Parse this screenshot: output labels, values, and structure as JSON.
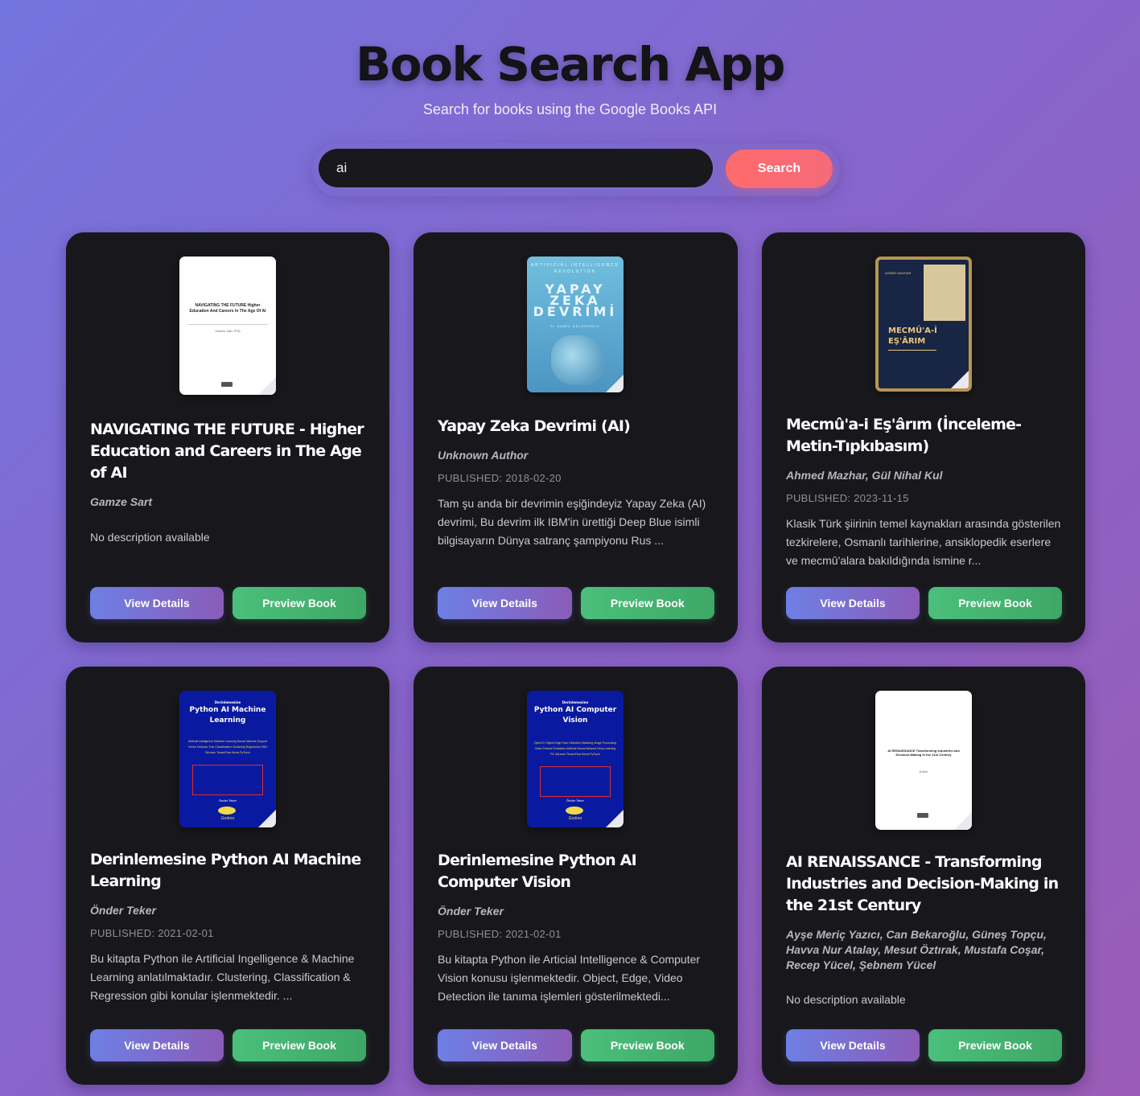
{
  "header": {
    "title": "Book Search App",
    "subtitle": "Search for books using the Google Books API"
  },
  "search": {
    "value": "ai",
    "button_label": "Search"
  },
  "books": [
    {
      "title": "NAVIGATING THE FUTURE - Higher Education and Careers in The Age of AI",
      "author": "Gamze Sart",
      "published": "",
      "description": "No description available",
      "cover": {
        "style": "white",
        "text": "NAVIGATING THE FUTURE Higher Education And Careers In The Age Of AI",
        "byline": "Gamze Sart, PhD"
      },
      "view_label": "View Details",
      "preview_label": "Preview Book"
    },
    {
      "title": "Yapay Zeka Devrimi (AI)",
      "author": "Unknown Author",
      "published": "PUBLISHED: 2018-02-20",
      "description": "Tam şu anda bir devrimin eşiğindeyiz Yapay Zeka (AI) devrimi, Bu devrim ilk IBM'in ürettiği Deep Blue isimli bilgisayarın Dünya satranç şampiyonu Rus ...",
      "cover": {
        "style": "blue",
        "small": "ARTIFICIAL INTELLIGENCE REVOLUTION",
        "big": "YAPAY ZEKA DEVRİMİ",
        "byline": "H. KAMİL ÇELENOĞLU"
      },
      "view_label": "View Details",
      "preview_label": "Preview Book"
    },
    {
      "title": "Mecmû'a-i Eş'ârım (İnceleme-Metin-Tıpkıbasım)",
      "author": "Ahmed Mazhar, Gül Nihal Kul",
      "published": "PUBLISHED: 2023-11-15",
      "description": "Klasik Türk şiirinin temel kaynakları arasında gösterilen tezkirelere, Osmanlı tarihlerine, ansiklopedik eserlere ve mecmû'alara bakıldığında ismine r...",
      "cover": {
        "style": "navy",
        "text": "MECMÛ'A-İ EŞ'ÂRIM",
        "byline": "AHMED MAZHAR"
      },
      "view_label": "View Details",
      "preview_label": "Preview Book"
    },
    {
      "title": "Derinlemesine Python AI Machine Learning",
      "author": "Önder Teker",
      "published": "PUBLISHED: 2021-02-01",
      "description": "Bu kitapta Python ile Artificial Ingelligence & Machine Learning anlatılmaktadır. Clustering, Classification & Regression gibi konular işlenmektedir. ...",
      "cover": {
        "style": "python",
        "small": "Derinlemesine",
        "text": "Python AI Machine Learning",
        "keywords": "Artificial Intelligence Machine Learning Neural Network Support Vector Decision Tree Classification Clustering Regression KNN SkLearn TensorFlow Keras PyTorch",
        "byline": "Önder Teker",
        "publisher": "Godoro"
      },
      "view_label": "View Details",
      "preview_label": "Preview Book"
    },
    {
      "title": "Derinlemesine Python AI Computer Vision",
      "author": "Önder Teker",
      "published": "PUBLISHED: 2021-02-01",
      "description": "Bu kitapta Python ile Articial Intelligence & Computer Vision konusu işlenmektedir. Object, Edge, Video Detection ile tanıma işlemleri gösterilmektedi...",
      "cover": {
        "style": "python",
        "small": "Derinlemesine",
        "text": "Python AI Computer Vision",
        "keywords": "OpenCV Object Edge Face Detection Matching Image Processing Video Feature Extraction Artificial Neural Network Deep Learning PIL SkLearn TensorFlow Keras PyTorch",
        "byline": "Önder Teker",
        "publisher": "Godoro"
      },
      "view_label": "View Details",
      "preview_label": "Preview Book"
    },
    {
      "title": "AI RENAISSANCE - Transforming Industries and Decision-Making in the 21st Century",
      "author": "Ayşe Meriç Yazıcı, Can Bekaroğlu, Güneş Topçu, Havva Nur Atalay, Mesut Öztırak, Mustafa Coşar, Recep Yücel, Şebnem Yücel",
      "published": "",
      "description": "No description available",
      "cover": {
        "style": "white",
        "text": "AI RENAISSANCE Transforming Industries and Decision-Making in the 21st Century",
        "byline": "Editör"
      },
      "view_label": "View Details",
      "preview_label": "Preview Book"
    }
  ]
}
